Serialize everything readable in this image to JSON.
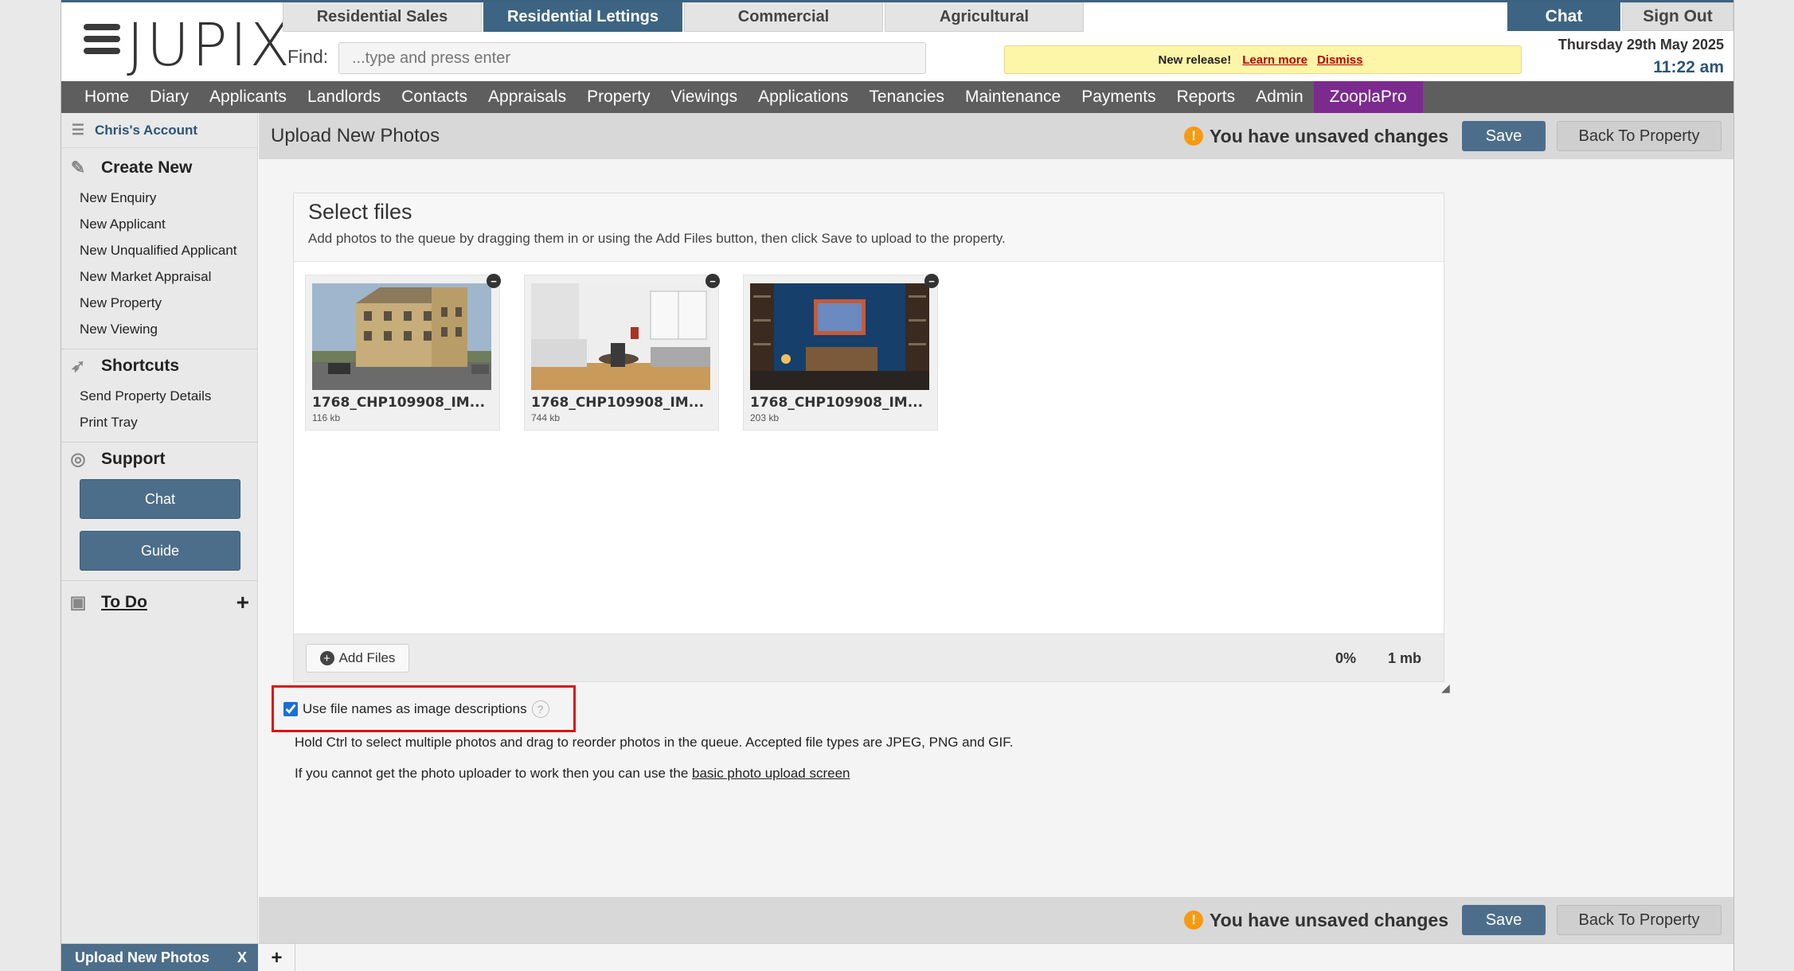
{
  "header": {
    "logo_text": "JUPIX",
    "dept_tabs": [
      "Residential Sales",
      "Residential Lettings",
      "Commercial",
      "Agricultural"
    ],
    "find_label": "Find:",
    "find_placeholder": "...type and press enter",
    "release_label": "New release!",
    "release_learn": "Learn more",
    "release_dismiss": "Dismiss",
    "chat_label": "Chat",
    "signout_label": "Sign Out",
    "date": "Thursday 29th May 2025",
    "time": "11:22 am"
  },
  "nav": [
    "Home",
    "Diary",
    "Applicants",
    "Landlords",
    "Contacts",
    "Appraisals",
    "Property",
    "Viewings",
    "Applications",
    "Tenancies",
    "Maintenance",
    "Payments",
    "Reports",
    "Admin",
    "ZooplaPro"
  ],
  "sidebar": {
    "account": "Chris's Account",
    "create_new": "Create New",
    "create_items": [
      "New Enquiry",
      "New Applicant",
      "New Unqualified Applicant",
      "New Market Appraisal",
      "New Property",
      "New Viewing"
    ],
    "shortcuts": "Shortcuts",
    "shortcut_items": [
      "Send Property Details",
      "Print Tray"
    ],
    "support": "Support",
    "chat_btn": "Chat",
    "guide_btn": "Guide",
    "todo": "To Do"
  },
  "page": {
    "title": "Upload New Photos",
    "unsaved": "You have unsaved changes",
    "save": "Save",
    "back": "Back To Property",
    "select_title": "Select files",
    "select_desc": "Add photos to the queue by dragging them in or using the Add Files button, then click Save to upload to the property.",
    "files": [
      {
        "name": "1768_CHP109908_IM...",
        "size": "116 kb"
      },
      {
        "name": "1768_CHP109908_IM...",
        "size": "744 kb"
      },
      {
        "name": "1768_CHP109908_IM...",
        "size": "203 kb"
      }
    ],
    "add_files": "Add Files",
    "progress": "0%",
    "total_size": "1 mb",
    "use_filenames": "Use file names as image descriptions",
    "use_filenames_checked": true,
    "hint": "Hold Ctrl to select multiple photos and drag to reorder photos in the queue. Accepted file types are JPEG, PNG and GIF.",
    "fallback_prefix": "If you cannot get the photo uploader to work then you can use the ",
    "fallback_link": "basic photo upload screen"
  },
  "bottom_tabs": {
    "active": "Upload New Photos",
    "close": "X",
    "add": "+"
  }
}
